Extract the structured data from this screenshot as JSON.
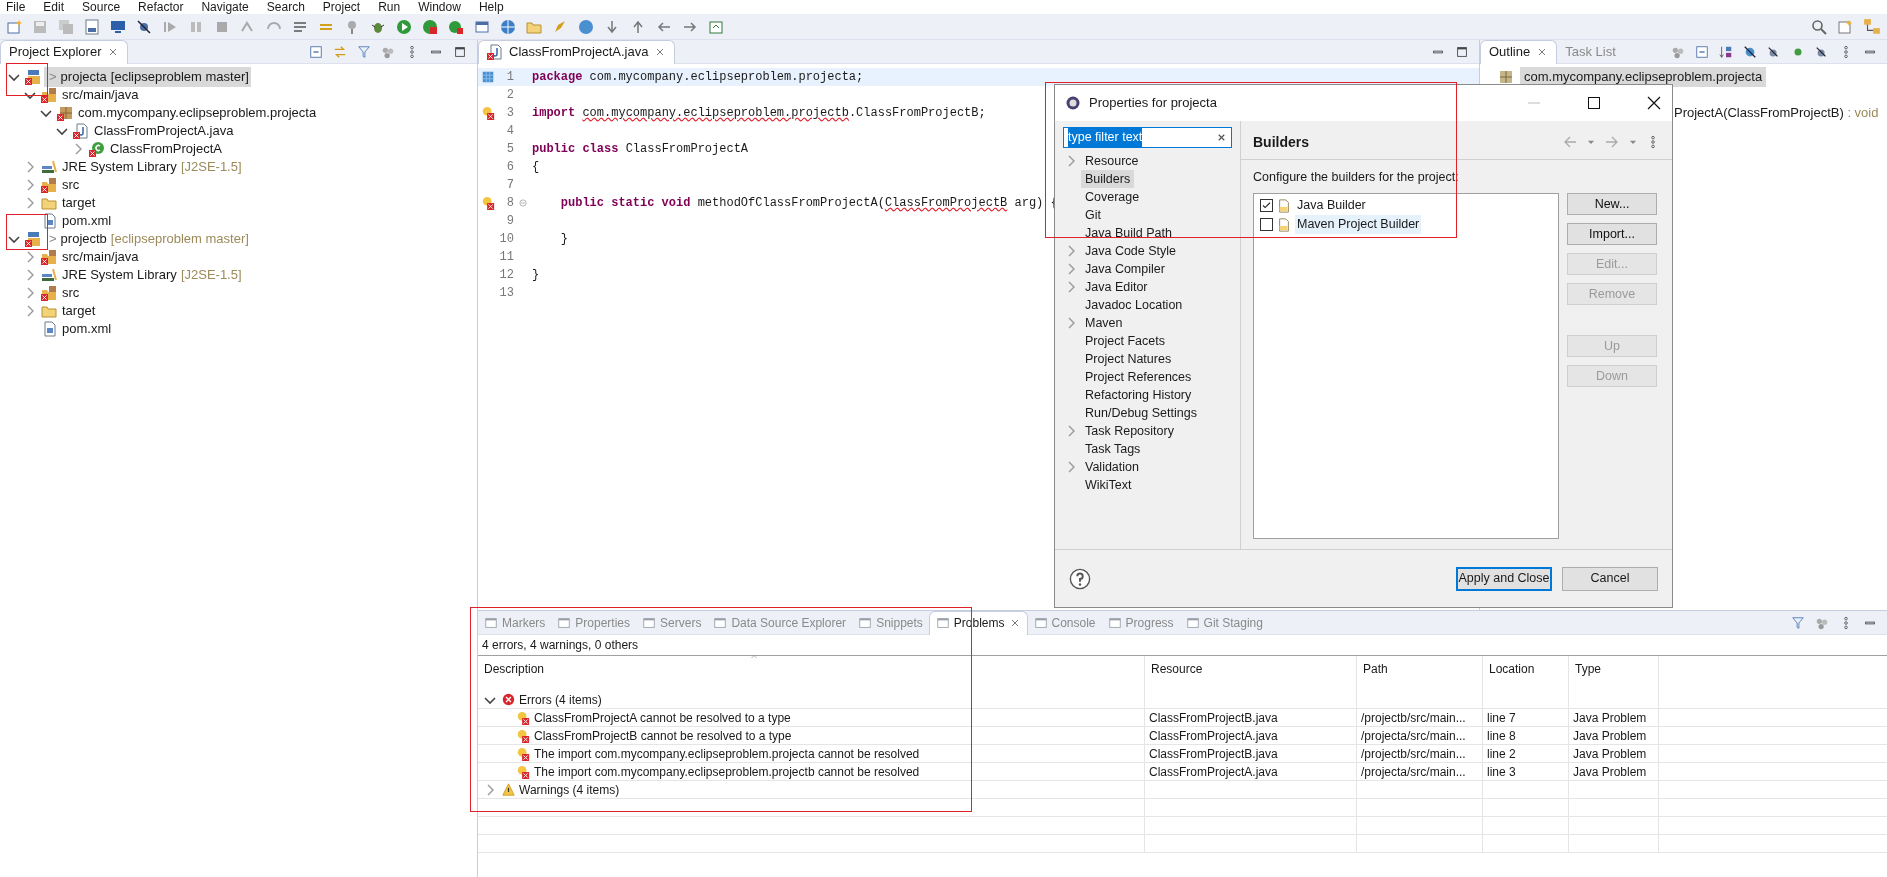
{
  "menu": [
    "File",
    "Edit",
    "Source",
    "Refactor",
    "Navigate",
    "Search",
    "Project",
    "Run",
    "Window",
    "Help"
  ],
  "explorer": {
    "tab": {
      "label": "Project Explorer",
      "selected": true
    },
    "items": [
      {
        "label": "projecta",
        "prefix": ">",
        "decoration": "[eclipseproblem master]",
        "kind": "project",
        "error": true,
        "expanded": true,
        "selected": true,
        "children": [
          {
            "label": "src/main/java",
            "kind": "source-folder",
            "error": true,
            "expanded": true,
            "selected": false,
            "children": [
              {
                "label": "com.mycompany.eclipseproblem.projecta",
                "kind": "package",
                "error": true,
                "expanded": true,
                "selected": false,
                "children": [
                  {
                    "label": "ClassFromProjectA.java",
                    "kind": "java-file",
                    "error": true,
                    "expanded": true,
                    "selected": false,
                    "children": [
                      {
                        "label": "ClassFromProjectA",
                        "kind": "class",
                        "error": true,
                        "expanded": false,
                        "selected": false
                      }
                    ]
                  }
                ]
              }
            ]
          },
          {
            "label": "JRE System Library",
            "decoration": "[J2SE-1.5]",
            "kind": "library",
            "error": false,
            "expanded": false,
            "selected": false
          },
          {
            "label": "src",
            "kind": "source-folder",
            "error": true,
            "expanded": false,
            "selected": false
          },
          {
            "label": "target",
            "kind": "folder",
            "error": false,
            "expanded": false,
            "selected": false
          },
          {
            "label": "pom.xml",
            "kind": "xml-file",
            "error": false,
            "selected": false
          }
        ]
      },
      {
        "label": "projectb",
        "prefix": ">",
        "decoration": "[eclipseproblem master]",
        "kind": "project",
        "error": true,
        "expanded": true,
        "selected": false,
        "children": [
          {
            "label": "src/main/java",
            "kind": "source-folder",
            "error": true,
            "expanded": false,
            "selected": false
          },
          {
            "label": "JRE System Library",
            "decoration": "[J2SE-1.5]",
            "kind": "library",
            "error": false,
            "expanded": false,
            "selected": false
          },
          {
            "label": "src",
            "kind": "source-folder",
            "error": true,
            "expanded": false,
            "selected": false
          },
          {
            "label": "target",
            "kind": "folder",
            "error": false,
            "expanded": false,
            "selected": false
          },
          {
            "label": "pom.xml",
            "kind": "xml-file",
            "error": false,
            "selected": false
          }
        ]
      }
    ]
  },
  "editor": {
    "tabs": [
      {
        "label": "ClassFromProjectA.java",
        "selected": true
      }
    ],
    "lines": [
      {
        "number": "1",
        "current": true,
        "kind": "bookmark",
        "tokens": [
          {
            "text": "package ",
            "kind": "keyword"
          },
          {
            "text": "com.mycompany.eclipseproblem.projecta;",
            "kind": "plain"
          }
        ]
      },
      {
        "number": "2",
        "current": false
      },
      {
        "number": "3",
        "current": false,
        "kind": "error",
        "tokens": [
          {
            "text": "import ",
            "kind": "keyword"
          },
          {
            "text": "com.mycompany.eclipseproblem.projectb",
            "kind": "error"
          },
          {
            "text": ".ClassFromProjectB;",
            "kind": "plain"
          }
        ]
      },
      {
        "number": "4",
        "current": false
      },
      {
        "number": "5",
        "current": false,
        "tokens": [
          {
            "text": "public class ",
            "kind": "keyword"
          },
          {
            "text": "ClassFromProjectA",
            "kind": "plain"
          }
        ]
      },
      {
        "number": "6",
        "current": false,
        "tokens": [
          {
            "text": "{",
            "kind": "plain"
          }
        ]
      },
      {
        "number": "7",
        "current": false
      },
      {
        "number": "8",
        "current": false,
        "kind": "error",
        "foldable": true,
        "tokens": [
          {
            "text": "    public static void ",
            "kind": "keyword"
          },
          {
            "text": "methodOfClassFromProjectA(",
            "kind": "plain"
          },
          {
            "text": "ClassFromProjectB",
            "kind": "error"
          },
          {
            "text": " arg) {",
            "kind": "plain"
          }
        ]
      },
      {
        "number": "9",
        "current": false
      },
      {
        "number": "10",
        "current": false,
        "tokens": [
          {
            "text": "    }",
            "kind": "plain"
          }
        ]
      },
      {
        "number": "11",
        "current": false
      },
      {
        "number": "12",
        "current": false,
        "tokens": [
          {
            "text": "}",
            "kind": "plain"
          }
        ]
      },
      {
        "number": "13",
        "current": false
      }
    ]
  },
  "outline": {
    "tabs": [
      {
        "label": "Outline",
        "selected": true
      },
      {
        "label": "Task List",
        "selected": false
      }
    ],
    "items": [
      {
        "label": "com.mycompany.eclipseproblem.projecta",
        "kind": "package",
        "selected": true
      },
      {
        "label": "ProjectA(ClassFromProjectB)",
        "detail": " : void",
        "kind": "method",
        "selected": false
      }
    ]
  },
  "dialog": {
    "title": "Properties for projecta",
    "filter": {
      "value": "type filter text"
    },
    "nav": [
      {
        "label": "Resource",
        "expanded": false,
        "selected": false
      },
      {
        "label": "Builders",
        "selected": true
      },
      {
        "label": "Coverage",
        "selected": false
      },
      {
        "label": "Git",
        "selected": false
      },
      {
        "label": "Java Build Path",
        "selected": false
      },
      {
        "label": "Java Code Style",
        "expanded": false,
        "selected": false
      },
      {
        "label": "Java Compiler",
        "expanded": false,
        "selected": false
      },
      {
        "label": "Java Editor",
        "expanded": false,
        "selected": false
      },
      {
        "label": "Javadoc Location",
        "selected": false
      },
      {
        "label": "Maven",
        "expanded": false,
        "selected": false
      },
      {
        "label": "Project Facets",
        "selected": false
      },
      {
        "label": "Project Natures",
        "selected": false
      },
      {
        "label": "Project References",
        "selected": false
      },
      {
        "label": "Refactoring History",
        "selected": false
      },
      {
        "label": "Run/Debug Settings",
        "selected": false
      },
      {
        "label": "Task Repository",
        "expanded": false,
        "selected": false
      },
      {
        "label": "Task Tags",
        "selected": false
      },
      {
        "label": "Validation",
        "expanded": false,
        "selected": false
      },
      {
        "label": "WikiText",
        "selected": false
      }
    ],
    "page_title": "Builders",
    "description": "Configure the builders for the project:",
    "builders": [
      {
        "label": "Java Builder",
        "checked": true,
        "selected": false
      },
      {
        "label": "Maven Project Builder",
        "checked": false,
        "selected": true
      }
    ],
    "side_button_groups": [
      [
        {
          "label": "New...",
          "disabled": false
        },
        {
          "label": "Import...",
          "disabled": false
        },
        {
          "label": "Edit...",
          "disabled": true
        },
        {
          "label": "Remove",
          "disabled": true
        }
      ],
      [
        {
          "label": "Up",
          "disabled": true
        },
        {
          "label": "Down",
          "disabled": true
        }
      ]
    ],
    "footer_buttons": [
      {
        "label": "Apply and Close",
        "kind": "default"
      },
      {
        "label": "Cancel",
        "kind": "normal"
      }
    ]
  },
  "problems": {
    "tabs": [
      {
        "label": "Markers",
        "selected": false
      },
      {
        "label": "Properties",
        "selected": false
      },
      {
        "label": "Servers",
        "selected": false
      },
      {
        "label": "Data Source Explorer",
        "selected": false
      },
      {
        "label": "Snippets",
        "selected": false
      },
      {
        "label": "Problems",
        "selected": true
      },
      {
        "label": "Console",
        "selected": false
      },
      {
        "label": "Progress",
        "selected": false
      },
      {
        "label": "Git Staging",
        "selected": false
      }
    ],
    "summary": "4 errors, 4 warnings, 0 others",
    "columns": [
      "Description",
      "Resource",
      "Path",
      "Location",
      "Type"
    ],
    "groups": [
      {
        "label": "Errors (4 items)",
        "kind": "error",
        "expanded": true,
        "rows": [
          {
            "description": "ClassFromProjectA cannot be resolved to a type",
            "resource": "ClassFromProjectB.java",
            "path": "/projectb/src/main...",
            "location": "line 7",
            "type": "Java Problem"
          },
          {
            "description": "ClassFromProjectB cannot be resolved to a type",
            "resource": "ClassFromProjectA.java",
            "path": "/projecta/src/main...",
            "location": "line 8",
            "type": "Java Problem"
          },
          {
            "description": "The import com.mycompany.eclipseproblem.projecta cannot be resolved",
            "resource": "ClassFromProjectB.java",
            "path": "/projectb/src/main...",
            "location": "line 2",
            "type": "Java Problem"
          },
          {
            "description": "The import com.mycompany.eclipseproblem.projectb cannot be resolved",
            "resource": "ClassFromProjectA.java",
            "path": "/projecta/src/main...",
            "location": "line 3",
            "type": "Java Problem"
          }
        ]
      },
      {
        "label": "Warnings (4 items)",
        "kind": "warning",
        "expanded": false
      }
    ]
  }
}
